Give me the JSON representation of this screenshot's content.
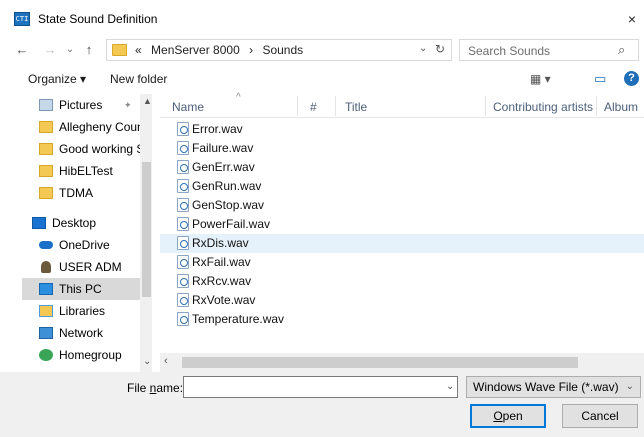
{
  "window": {
    "title": "State Sound Definition",
    "close": "×",
    "app_icon_text": "CTI"
  },
  "nav": {
    "back": "←",
    "forward": "→",
    "recent": "⌄",
    "up": "↑"
  },
  "address": {
    "prefix": "«",
    "crumbs": [
      "MenServer 8000",
      "Sounds"
    ],
    "separator": "›",
    "dropdown": "⌄",
    "refresh": "↻"
  },
  "search": {
    "placeholder": "Search Sounds",
    "icon": "⌕"
  },
  "toolbar": {
    "organize": "Organize ▾",
    "new_folder": "New folder",
    "view": "▦ ▾",
    "pane": "▭",
    "help": "?"
  },
  "sidebar": {
    "items": [
      {
        "label": "Pictures",
        "icon": "pictures-icon",
        "pin": "📌"
      },
      {
        "label": "Allegheny Coun",
        "icon": "folder-icon"
      },
      {
        "label": "Good working Sy",
        "icon": "folder-icon"
      },
      {
        "label": "HibELTest",
        "icon": "folder-icon"
      },
      {
        "label": "TDMA",
        "icon": "folder-icon"
      },
      {
        "label": "Desktop",
        "icon": "desktop-icon"
      },
      {
        "label": "OneDrive",
        "icon": "onedrive-icon"
      },
      {
        "label": "USER ADM",
        "icon": "user-icon"
      },
      {
        "label": "This PC",
        "icon": "computer-icon"
      },
      {
        "label": "Libraries",
        "icon": "libraries-icon"
      },
      {
        "label": "Network",
        "icon": "network-icon"
      },
      {
        "label": "Homegroup",
        "icon": "homegroup-icon"
      }
    ],
    "selected": "This PC",
    "expand": "⌄"
  },
  "columns": [
    "Name",
    "#",
    "Title",
    "Contributing artists",
    "Album"
  ],
  "sort_indicator": "^",
  "files": [
    "Error.wav",
    "Failure.wav",
    "GenErr.wav",
    "GenRun.wav",
    "GenStop.wav",
    "PowerFail.wav",
    "RxDis.wav",
    "RxFail.wav",
    "RxRcv.wav",
    "RxVote.wav",
    "Temperature.wav"
  ],
  "selected_file": "RxDis.wav",
  "bottom": {
    "filename_label_pre": "File ",
    "filename_label_ul": "n",
    "filename_label_post": "ame:",
    "filename_value": "",
    "filetype": "Windows Wave File (*.wav)",
    "open_ul": "O",
    "open_rest": "pen",
    "cancel": "Cancel"
  },
  "colors": {
    "accent": "#0078d7",
    "selection": "#e5f1fb",
    "folder": "#f3c853"
  }
}
